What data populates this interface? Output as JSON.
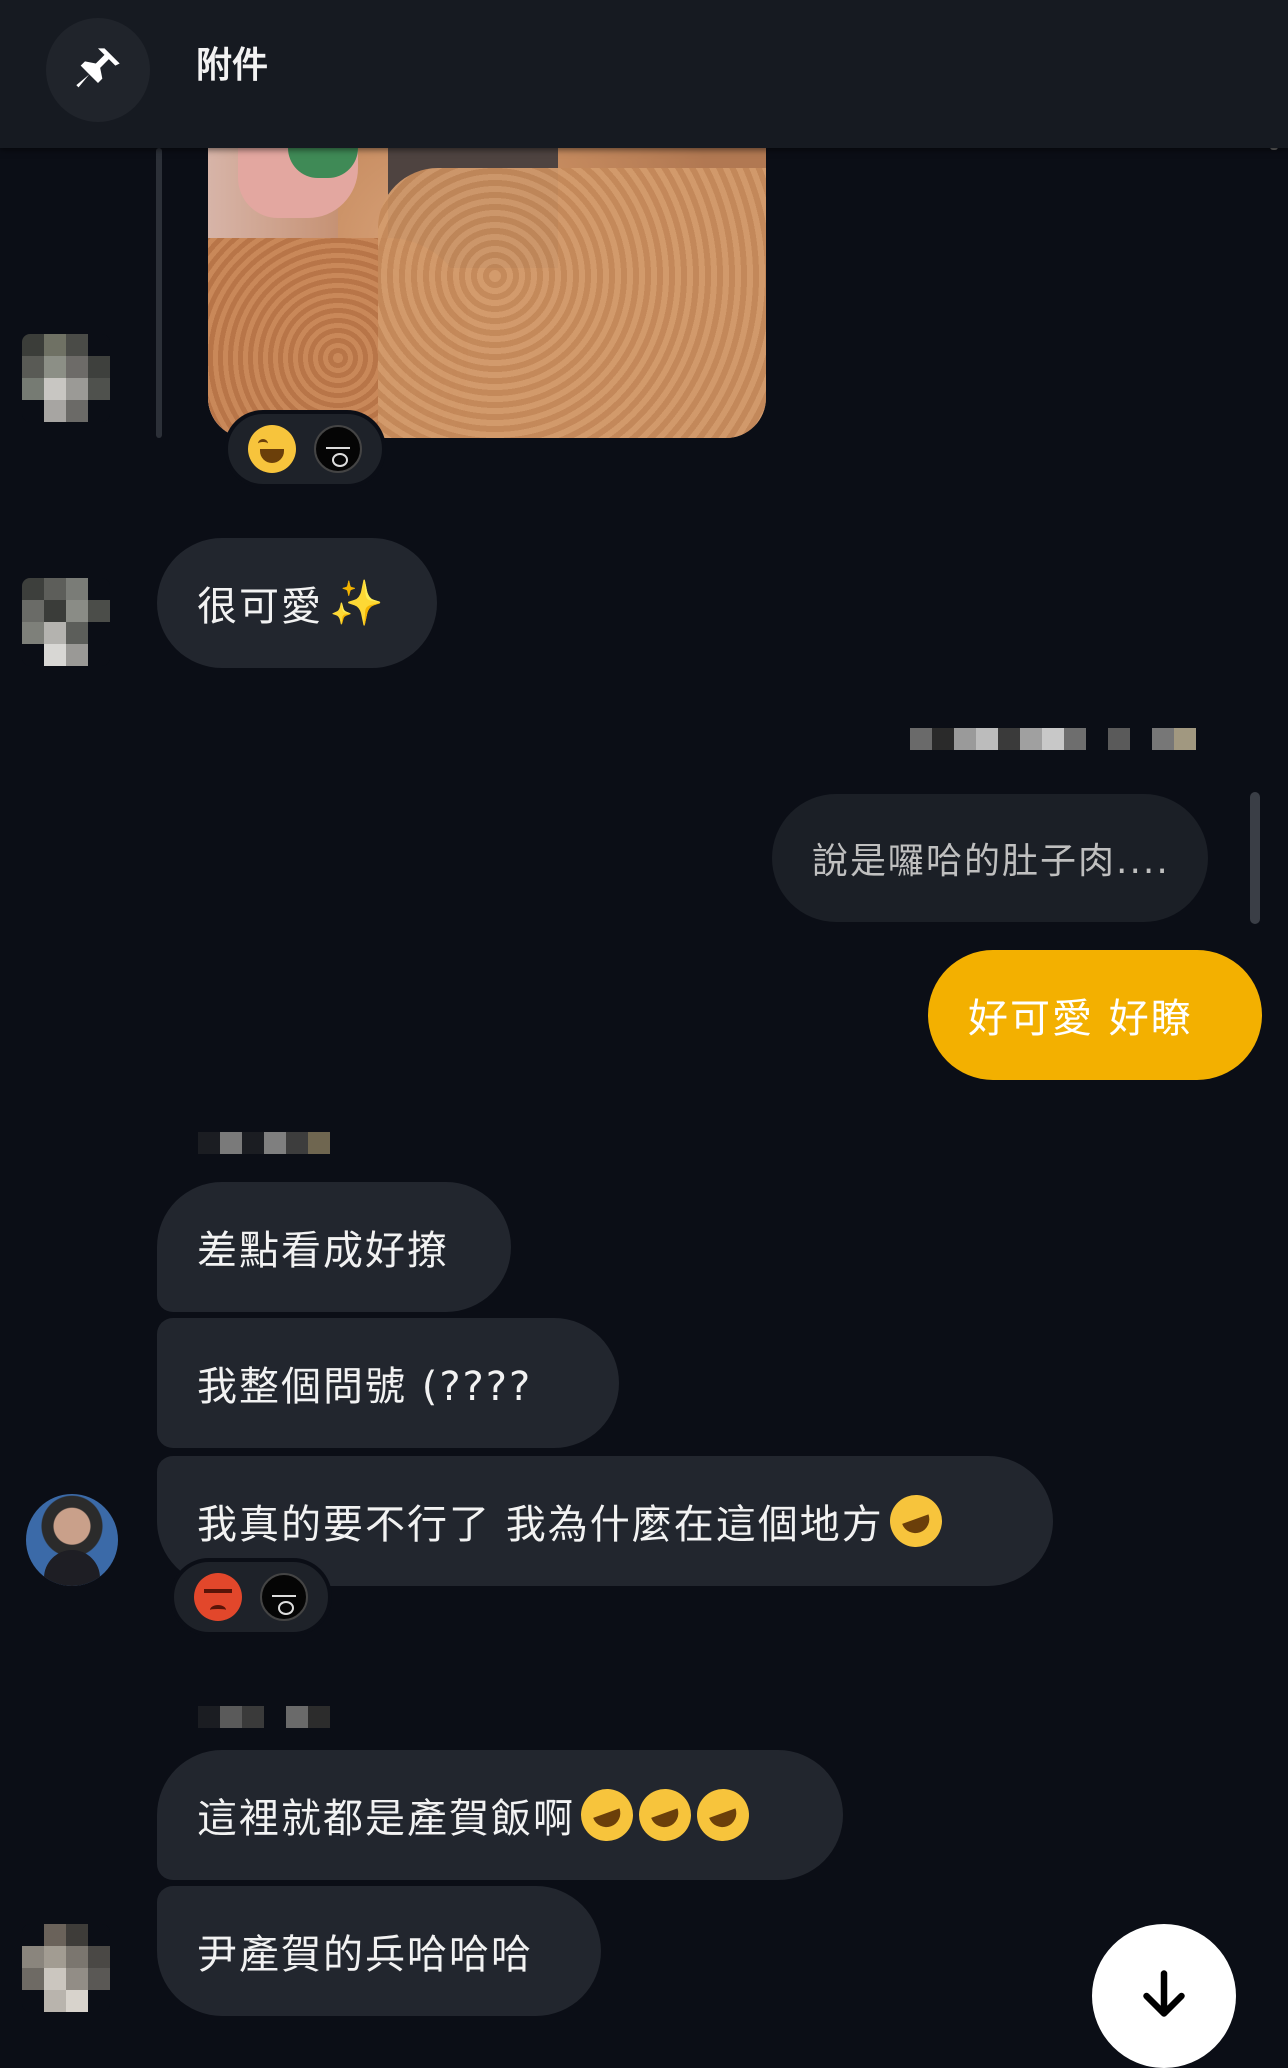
{
  "header": {
    "title": "附件",
    "pin_icon": "pin-icon"
  },
  "messages": {
    "image_reactions": [
      "face-with-tears-of-joy",
      "black-face-sticker"
    ],
    "m1": {
      "text": "很可愛"
    },
    "reply_quote": {
      "text": "說是囉哈的肚子肉...."
    },
    "mine": {
      "text": "好可愛  好瞭"
    },
    "m2": {
      "text": "差點看成好撩"
    },
    "m3": {
      "text": "我整個問號 (????"
    },
    "m4": {
      "text": "我真的要不行了  我為什麼在這個地方"
    },
    "m4_reactions": [
      "angry-face",
      "black-face-sticker"
    ],
    "m5": {
      "text": "這裡就都是產賀飯啊"
    },
    "m6": {
      "text": "尹產賀的兵哈哈哈"
    }
  },
  "colors": {
    "background": "#0b0e16",
    "bubble_other": "#22262e",
    "bubble_mine": "#f3b000",
    "header": "#161a21"
  },
  "controls": {
    "scroll_down": "arrow-down-icon"
  }
}
